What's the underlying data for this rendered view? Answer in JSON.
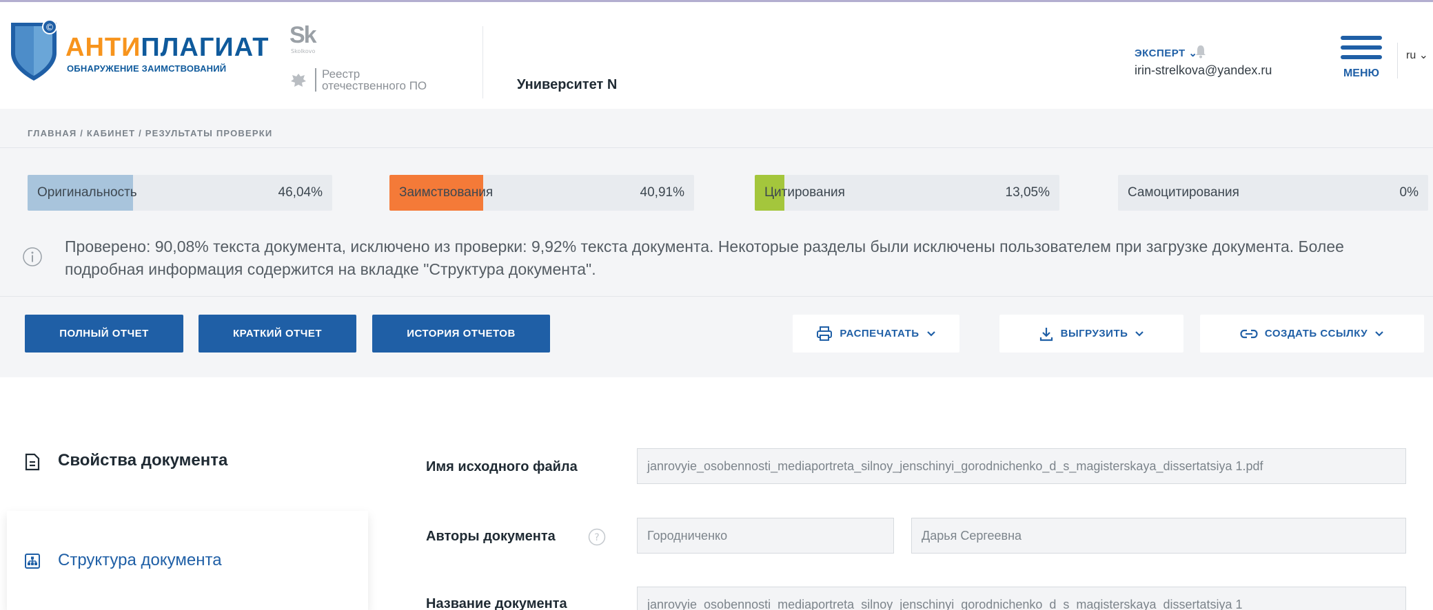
{
  "header": {
    "logo_title_a": "АНТИ",
    "logo_title_b": "ПЛАГИАТ",
    "logo_subtitle": "ОБНАРУЖЕНИЕ ЗАИМСТВОВАНИЙ",
    "sk_logo": "Sk",
    "sk_small": "Skolkovo",
    "registry_line1": "Реестр",
    "registry_line2": "отечественного ПО",
    "organization": "Университет N",
    "role": "ЭКСПЕРТ",
    "email": "irin-strelkova@yandex.ru",
    "menu_label": "МЕНЮ",
    "language": "ru"
  },
  "breadcrumb": "ГЛАВНАЯ / КАБИНЕТ / РЕЗУЛЬТАТЫ ПРОВЕРКИ",
  "stats": [
    {
      "name": "Оригинальность",
      "value": "46,04%",
      "fraction": 0.346,
      "color": "#a8c4dc"
    },
    {
      "name": "Заимствования",
      "value": "40,91%",
      "fraction": 0.3075,
      "color": "#f47a38"
    },
    {
      "name": "Цитирования",
      "value": "13,05%",
      "fraction": 0.0981,
      "color": "#a4c63c"
    },
    {
      "name": "Самоцитирования",
      "value": "0%",
      "fraction": 0,
      "color": "#c0c7ce"
    }
  ],
  "info_text": "Проверено: 90,08% текста документа, исключено из проверки: 9,92% текста документа. Некоторые разделы были исключены пользователем при загрузке документа. Более подробная информация содержится на вкладке \"Структура документа\".",
  "actions": {
    "full_report": "ПОЛНЫЙ ОТЧЕТ",
    "short_report": "КРАТКИЙ ОТЧЕТ",
    "report_history": "ИСТОРИЯ ОТЧЕТОВ",
    "print": "РАСПЕЧАТАТЬ",
    "export": "ВЫГРУЗИТЬ",
    "create_link": "СОЗДАТЬ ССЫЛКУ"
  },
  "sidebar": {
    "doc_properties": "Свойства документа",
    "doc_structure": "Структура документа"
  },
  "fields": {
    "source_file_label": "Имя исходного файла",
    "source_file_value": "janrovyie_osobennosti_mediaportreta_silnoy_jenschinyi_gorodnichenko_d_s_magisterskaya_dissertatsiya 1.pdf",
    "authors_label": "Авторы документа",
    "author_last": "Городниченко",
    "author_first": "Дарья Сергеевна",
    "title_label": "Название документа",
    "title_value": "janrovyie_osobennosti_mediaportreta_silnoy_jenschinyi_gorodnichenko_d_s_magisterskaya_dissertatsiya 1"
  }
}
